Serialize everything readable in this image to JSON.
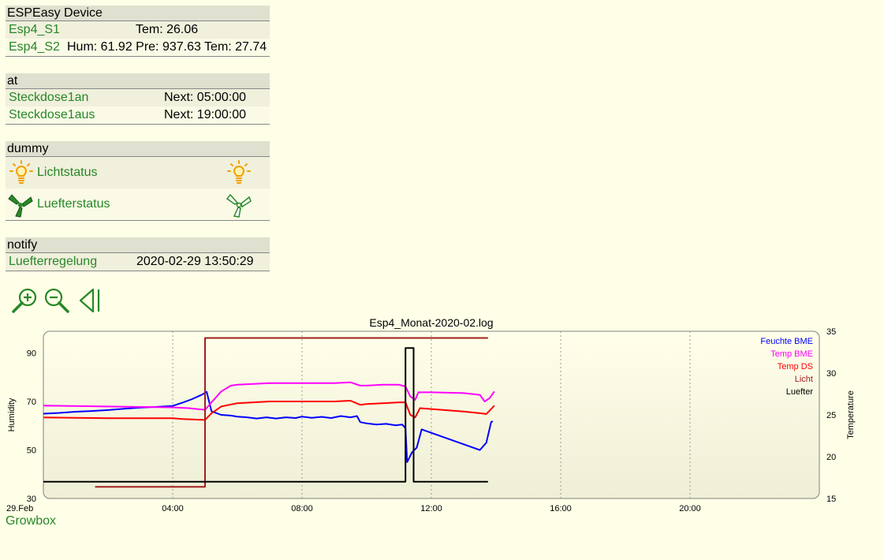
{
  "espeasy": {
    "title": "ESPEasy Device",
    "rows": [
      {
        "name": "Esp4_S1",
        "state": "Tem: 26.06"
      },
      {
        "name": "Esp4_S2",
        "state": "Hum: 61.92 Pre: 937.63 Tem: 27.74"
      }
    ]
  },
  "at": {
    "title": "at",
    "rows": [
      {
        "name": "Steckdose1an",
        "state": "Next: 05:00:00"
      },
      {
        "name": "Steckdose1aus",
        "state": "Next: 19:00:00"
      }
    ]
  },
  "dummy": {
    "title": "dummy",
    "rows": [
      {
        "name": "Lichtstatus",
        "icon": "bulb-icon"
      },
      {
        "name": "Luefterstatus",
        "icon": "fan-icon"
      }
    ]
  },
  "notify": {
    "title": "notify",
    "rows": [
      {
        "name": "Luefterregelung",
        "state": "2020-02-29 13:50:29"
      }
    ]
  },
  "controls": {
    "zoom_in": "zoom-in-icon",
    "zoom_out": "zoom-out-icon",
    "back": "back-icon"
  },
  "footer_link": "Growbox",
  "colors": {
    "link": "#278727",
    "feuchte": "#0000FF",
    "temp_bme": "#FF00FF",
    "temp_ds": "#FF0000",
    "licht": "#A02020",
    "luefter": "#000000"
  },
  "chart_data": {
    "type": "line",
    "title": "Esp4_Monat-2020-02.log",
    "x_start_label": "29.Feb",
    "x_ticks": [
      "04:00",
      "08:00",
      "12:00",
      "16:00",
      "20:00"
    ],
    "x_range_hours": [
      0,
      24
    ],
    "y_left": {
      "label": "Humidity",
      "ticks": [
        "30",
        "50",
        "70",
        "90"
      ],
      "range": [
        30,
        99
      ]
    },
    "y_right": {
      "label": "Temperature",
      "ticks": [
        "15",
        "20",
        "25",
        "30",
        "35"
      ],
      "range": [
        15,
        35
      ]
    },
    "legend_position": "top-right",
    "series": [
      {
        "name": "Feuchte BME",
        "axis": "left",
        "color": "#0000FF",
        "points": [
          [
            0,
            65
          ],
          [
            0.5,
            65.3
          ],
          [
            1,
            65.8
          ],
          [
            1.5,
            66.1
          ],
          [
            2,
            66.5
          ],
          [
            2.5,
            67
          ],
          [
            3,
            67.5
          ],
          [
            3.5,
            67.8
          ],
          [
            4,
            68.2
          ],
          [
            4.3,
            69.5
          ],
          [
            4.6,
            71
          ],
          [
            4.9,
            72.8
          ],
          [
            5.05,
            74
          ],
          [
            5.2,
            66
          ],
          [
            5.5,
            64.5
          ],
          [
            5.8,
            64.2
          ],
          [
            6,
            63.8
          ],
          [
            6.3,
            63.5
          ],
          [
            6.6,
            63
          ],
          [
            6.9,
            63.5
          ],
          [
            7.2,
            63
          ],
          [
            7.5,
            63.5
          ],
          [
            7.8,
            63.2
          ],
          [
            8,
            63.8
          ],
          [
            8.3,
            63.3
          ],
          [
            8.6,
            63.7
          ],
          [
            8.9,
            63.2
          ],
          [
            9.2,
            64
          ],
          [
            9.5,
            63.5
          ],
          [
            9.7,
            64
          ],
          [
            9.8,
            61.5
          ],
          [
            10,
            61
          ],
          [
            10.3,
            60.5
          ],
          [
            10.6,
            60.8
          ],
          [
            10.9,
            60.2
          ],
          [
            11.1,
            60.5
          ],
          [
            11.2,
            59
          ],
          [
            11.25,
            45
          ],
          [
            11.4,
            49
          ],
          [
            11.55,
            51
          ],
          [
            11.7,
            58.5
          ],
          [
            13.5,
            50
          ],
          [
            13.7,
            53
          ],
          [
            13.85,
            61.5
          ],
          [
            13.9,
            61.9
          ]
        ]
      },
      {
        "name": "Temp BME",
        "axis": "right",
        "color": "#FF00FF",
        "points": [
          [
            0,
            26.1
          ],
          [
            2,
            26
          ],
          [
            4,
            25.9
          ],
          [
            4.5,
            25.8
          ],
          [
            5,
            25.6
          ],
          [
            5.2,
            26.5
          ],
          [
            5.5,
            27.8
          ],
          [
            5.8,
            28.5
          ],
          [
            6,
            28.6
          ],
          [
            6.5,
            28.7
          ],
          [
            7,
            28.8
          ],
          [
            8,
            28.8
          ],
          [
            9,
            28.8
          ],
          [
            9.5,
            28.9
          ],
          [
            9.8,
            28.5
          ],
          [
            10,
            28.5
          ],
          [
            10.5,
            28.6
          ],
          [
            11,
            28.6
          ],
          [
            11.2,
            28.4
          ],
          [
            11.35,
            27.2
          ],
          [
            11.5,
            26.8
          ],
          [
            11.6,
            27.7
          ],
          [
            12,
            27.7
          ],
          [
            13,
            27.6
          ],
          [
            13.5,
            27.4
          ],
          [
            13.65,
            26.6
          ],
          [
            13.8,
            27
          ],
          [
            13.95,
            27.8
          ]
        ]
      },
      {
        "name": "Temp DS",
        "axis": "right",
        "color": "#FF0000",
        "points": [
          [
            0,
            24.7
          ],
          [
            2,
            24.6
          ],
          [
            4,
            24.6
          ],
          [
            4.3,
            24.5
          ],
          [
            5,
            24.4
          ],
          [
            5.2,
            25.2
          ],
          [
            5.5,
            26
          ],
          [
            6,
            26.4
          ],
          [
            6.5,
            26.5
          ],
          [
            7,
            26.6
          ],
          [
            8,
            26.6
          ],
          [
            9,
            26.6
          ],
          [
            9.5,
            26.7
          ],
          [
            9.8,
            26.2
          ],
          [
            10,
            26.3
          ],
          [
            10.5,
            26.4
          ],
          [
            11,
            26.5
          ],
          [
            11.2,
            26.5
          ],
          [
            11.35,
            25
          ],
          [
            11.5,
            24.7
          ],
          [
            11.65,
            25.8
          ],
          [
            12,
            25.7
          ],
          [
            13,
            25.4
          ],
          [
            13.5,
            25.2
          ],
          [
            13.7,
            25.1
          ],
          [
            13.95,
            26.1
          ]
        ]
      },
      {
        "name": "Licht",
        "axis": "right",
        "color": "#A02020",
        "step": true,
        "points": [
          [
            1.6,
            16.4
          ],
          [
            5,
            16.4
          ],
          [
            5,
            34.2
          ],
          [
            13.75,
            34.2
          ]
        ]
      },
      {
        "name": "Luefter",
        "axis": "right",
        "color": "#000000",
        "step": true,
        "points": [
          [
            0,
            17
          ],
          [
            11.2,
            17
          ],
          [
            11.2,
            33
          ],
          [
            11.45,
            33
          ],
          [
            11.45,
            17
          ],
          [
            13.75,
            17
          ]
        ]
      }
    ]
  }
}
